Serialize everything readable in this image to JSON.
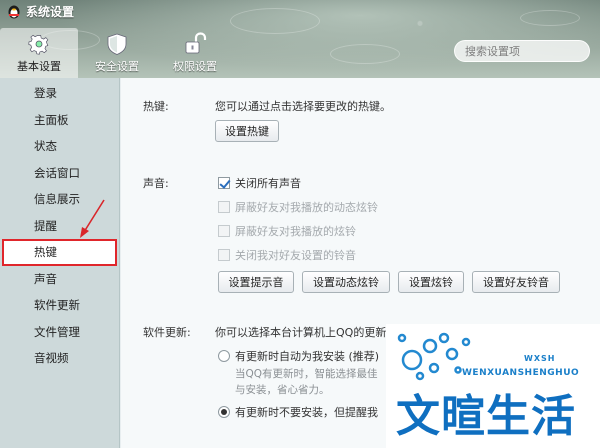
{
  "window": {
    "title": "系统设置"
  },
  "top_tabs": [
    {
      "label": "基本设置",
      "icon": "gear-icon",
      "active": true
    },
    {
      "label": "安全设置",
      "icon": "shield-icon",
      "active": false
    },
    {
      "label": "权限设置",
      "icon": "unlock-icon",
      "active": false
    }
  ],
  "search": {
    "placeholder": "搜索设置项"
  },
  "sidebar": {
    "items": [
      {
        "label": "登录"
      },
      {
        "label": "主面板"
      },
      {
        "label": "状态"
      },
      {
        "label": "会话窗口"
      },
      {
        "label": "信息展示"
      },
      {
        "label": "提醒"
      },
      {
        "label": "热键",
        "active": true
      },
      {
        "label": "声音"
      },
      {
        "label": "软件更新"
      },
      {
        "label": "文件管理"
      },
      {
        "label": "音视频"
      }
    ]
  },
  "hotkey": {
    "label": "热键:",
    "description": "您可以通过点击选择要更改的热键。",
    "button": "设置热键"
  },
  "sound": {
    "label": "声音:",
    "checkboxes": [
      {
        "label": "关闭所有声音",
        "checked": true,
        "disabled": false
      },
      {
        "label": "屏蔽好友对我播放的动态炫铃",
        "checked": false,
        "disabled": true
      },
      {
        "label": "屏蔽好友对我播放的炫铃",
        "checked": false,
        "disabled": true
      },
      {
        "label": "关闭我对好友设置的铃音",
        "checked": false,
        "disabled": true
      }
    ],
    "buttons": [
      "设置提示音",
      "设置动态炫铃",
      "设置炫铃",
      "设置好友铃音"
    ]
  },
  "update": {
    "label": "软件更新:",
    "description": "你可以选择本台计算机上QQ的更新",
    "options": [
      {
        "label": "有更新时自动为我安装 (推荐)",
        "checked": false,
        "hints": [
          "当QQ有更新时，智能选择最佳",
          "与安装，省心省力。"
        ]
      },
      {
        "label": "有更新时不要安装，但提醒我",
        "checked": true
      }
    ]
  },
  "watermark": {
    "tag": "WXSH",
    "url_text": "WENXUANSHENGHUO",
    "brand": "文暄生活"
  },
  "colors": {
    "highlight_border": "#e0262b",
    "arrow": "#d9262a",
    "sidebar_bg": "#cdd9da",
    "brand_blue": "#0f6fc0"
  }
}
